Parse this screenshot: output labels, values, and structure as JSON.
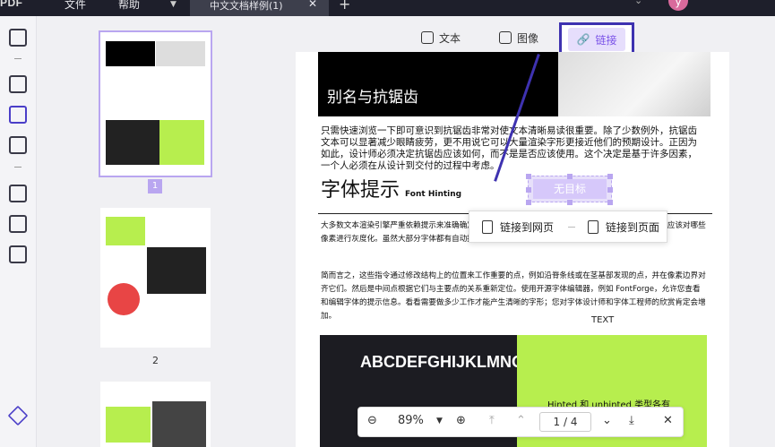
{
  "app": {
    "logo": "PDF",
    "menu": [
      "文件",
      "帮助"
    ],
    "tab_title": "中文文档样例(1)",
    "avatar": "y"
  },
  "toolbar": {
    "text": "文本",
    "image": "图像",
    "link": "链接"
  },
  "thumbs": {
    "page1": "1",
    "page2": "2"
  },
  "doc": {
    "hero_title": "别名与抗锯齿",
    "para": "只需快速浏览一下即可意识到抗锯齿非常对使文本清晰易读很重要。除了少数例外，抗锯齿文本可以显著减少眼睛疲劳，更不用说它可以大量渲染字形更接近他们的预期设计。正因为如此，设计师必须决定抗锯齿应该如何，而不是是否应该使用。这个决定是基于许多因素，一个人必须在从设计到交付的过程中考虑。",
    "heading": "字体提示",
    "heading_en": "Font Hinting",
    "small1": "大多数文本渲染引擎严重依赖提示来准确确定字体大小和位置。提示是用于字体与像素对齐网格并确定应该对哪些像素进行灰度化。虽然大部分字体都有自动提示，但一些字体由类型设计师手动完成并嵌入文件。",
    "small2": "简而言之，这些指令通过修改结构上的位置来工作重要的点，例如沿脊条线或在茎基部发现的点，并在像素边界对齐它们。然后是中间点根据它们与主要点的关系重新定位。使用开源字体编辑器，例如 FontForge，允许您查看和编辑字体的提示信息。看看需要做多少工作才能产生清晰的字形；您对字体设计师和字体工程师的欣赏肯定会增加。",
    "text_label": "TEXT",
    "img_text": "ABCDEFGHIJKLMNO",
    "green_text": "Hinted 和 unhinted 类型各有"
  },
  "target": {
    "label": "无目标"
  },
  "popup": {
    "web": "链接到网页",
    "page": "链接到页面"
  },
  "zoom": {
    "value": "89%",
    "current": "1",
    "total": "4"
  }
}
